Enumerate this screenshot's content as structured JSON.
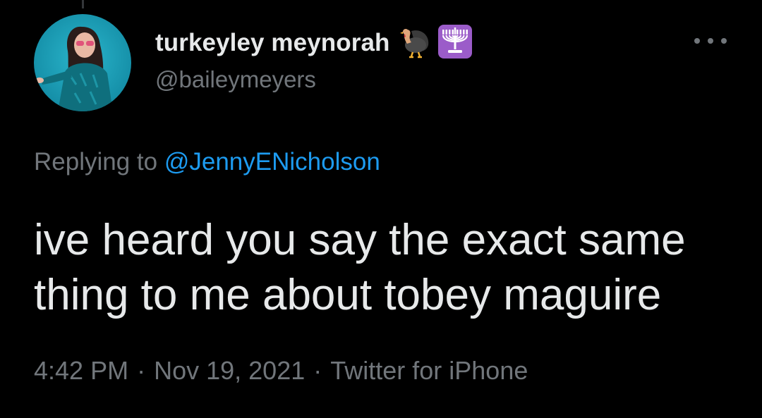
{
  "tweet": {
    "display_name": "turkeyley meynorah",
    "name_emojis": [
      "turkey-emoji",
      "menorah-emoji"
    ],
    "handle": "@baileymeyers",
    "replying_label": "Replying to",
    "replying_to": "@JennyENicholson",
    "text": "ive heard you say the exact same\nthing to me about tobey maguire",
    "time": "4:42 PM",
    "date": "Nov 19, 2021",
    "separator": "·",
    "source": "Twitter for iPhone"
  },
  "more_icon": "more-horizontal-icon",
  "colors": {
    "background": "#000000",
    "primary_text": "#e7e9ea",
    "secondary_text": "#71767b",
    "link": "#1d9bf0",
    "avatar_bg": "#1ba3bd"
  }
}
